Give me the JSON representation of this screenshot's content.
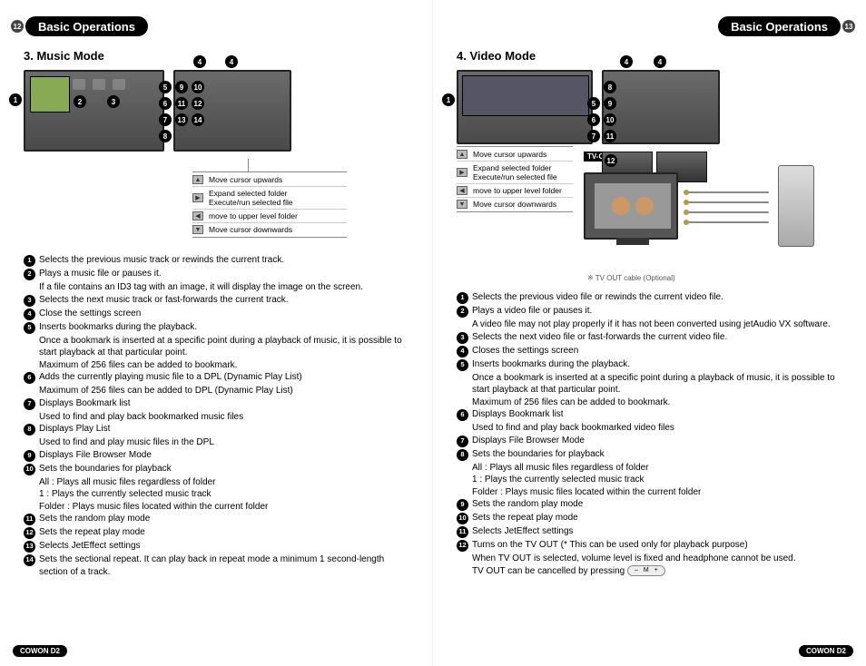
{
  "header": {
    "left_title": "Basic Operations",
    "right_title": "Basic Operations"
  },
  "page_numbers": {
    "left": "12",
    "right": "13"
  },
  "footer": {
    "label": "COWON D2"
  },
  "music": {
    "section_title": "3. Music Mode",
    "legend": {
      "up": "Move cursor upwards",
      "expand_l1": "Expand selected folder",
      "expand_l2": "Execute/run selected file",
      "back": "move to upper level folder",
      "down": "Move cursor downwards"
    },
    "items": {
      "1": {
        "main": "Selects the previous music track or rewinds the current track."
      },
      "2": {
        "main": "Plays a music file or pauses it.",
        "sub1": "If a file contains an ID3 tag with an image, it will display the image on the screen."
      },
      "3": {
        "main": "Selects the next music track or fast-forwards the current track."
      },
      "4": {
        "main": "Close the settings screen"
      },
      "5": {
        "main": "Inserts bookmarks during the playback.",
        "sub1": "Once a bookmark is inserted at a specific point during a playback of music, it is possible to start playback at that particular point.",
        "sub2": "Maximum of 256 files can be added to bookmark."
      },
      "6": {
        "main": "Adds the currently playing music file to a DPL (Dynamic Play List)",
        "sub1": "Maximum of 256 files can be added to DPL (Dynamic Play List)"
      },
      "7": {
        "main": "Displays Bookmark list",
        "sub1": "Used to find and play back bookmarked music files"
      },
      "8": {
        "main": "Displays Play List",
        "sub1": "Used to find and play music files in the DPL"
      },
      "9": {
        "main": "Displays File Browser Mode"
      },
      "10": {
        "main": "Sets the boundaries for playback",
        "sub1": "All : Plays all music files regardless of folder",
        "sub2": "1 : Plays the currently selected music track",
        "sub3": "Folder : Plays music files located within the current folder"
      },
      "11": {
        "main": "Sets the random play mode"
      },
      "12": {
        "main": "Sets the repeat play mode"
      },
      "13": {
        "main": "Selects JetEffect settings"
      },
      "14": {
        "main": "Sets the sectional repeat. It can play back in repeat mode a minimum 1 second-length section of a track."
      }
    }
  },
  "video": {
    "section_title": "4. Video Mode",
    "legend": {
      "up": "Move cursor upwards",
      "expand_l1": "Expand selected folder",
      "expand_l2": "Execute/run selected file",
      "back": "move to upper level folder",
      "down": "Move cursor downwards"
    },
    "tvout": {
      "label": "TV-OUT",
      "caption": "※ TV OUT cable (Optional)"
    },
    "button_pill": {
      "minus": "–",
      "m": "M",
      "plus": "+"
    },
    "items": {
      "1": {
        "main": "Selects the previous video file or rewinds the current video file."
      },
      "2": {
        "main": "Plays a video file or pauses it.",
        "sub1": "A video file may not play properly if it has not been converted using jetAudio VX software."
      },
      "3": {
        "main": "Selects the next video file or fast-forwards the current video file."
      },
      "4": {
        "main": "Closes the settings screen"
      },
      "5": {
        "main": "Inserts bookmarks during the playback.",
        "sub1": "Once a bookmark is inserted at a specific point during a playback of music, it is possible to start playback at that particular point.",
        "sub2": "Maximum of 256 files can be added to bookmark."
      },
      "6": {
        "main": "Displays Bookmark list",
        "sub1": "Used to find and play back bookmarked video files"
      },
      "7": {
        "main": "Displays File Browser Mode"
      },
      "8": {
        "main": "Sets the boundaries for playback",
        "sub1": "All : Plays all music files regardless of folder",
        "sub2": "1 : Plays the currently selected music track",
        "sub3": "Folder : Plays music files located within the current folder"
      },
      "9": {
        "main": "Sets the random play mode"
      },
      "10": {
        "main": "Sets the repeat play mode"
      },
      "11": {
        "main": "Selects JetEffect settings"
      },
      "12": {
        "main": "Turns on the TV OUT (* This can be used only for playback purpose)",
        "sub1": "When TV OUT is selected, volume level is fixed and headphone cannot be used.",
        "sub2_prefix": "TV OUT can be cancelled by pressing"
      }
    }
  }
}
